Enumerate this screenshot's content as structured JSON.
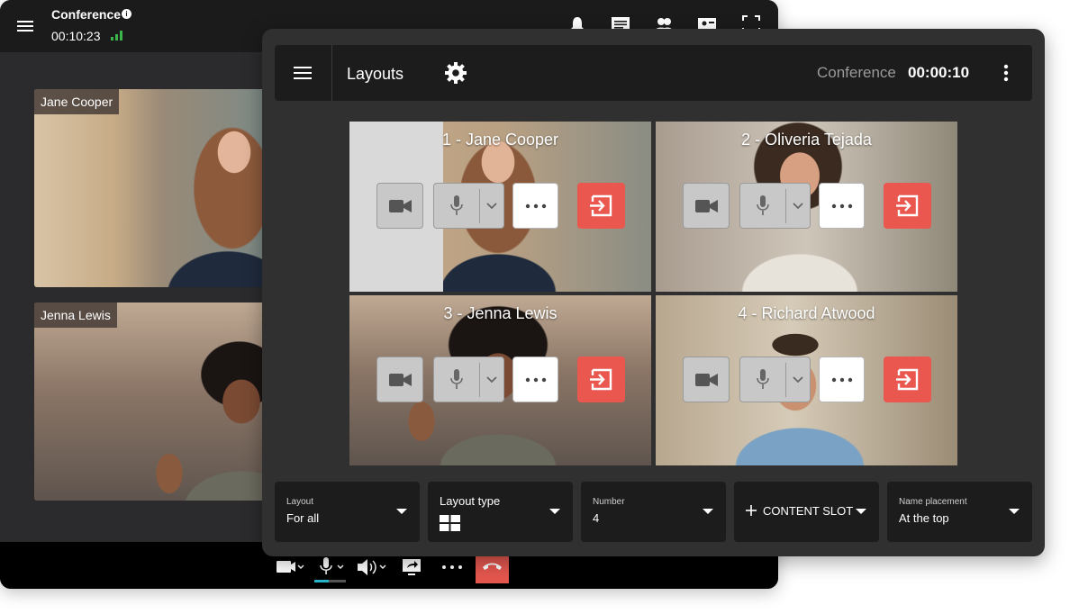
{
  "back_window": {
    "title": "Conference",
    "info": "i",
    "elapsed": "00:10:23",
    "participants": [
      {
        "name": "Jane Cooper"
      },
      {
        "name": "Jenna Lewis"
      }
    ]
  },
  "front_panel": {
    "header": {
      "title": "Layouts",
      "conference_label": "Conference",
      "elapsed": "00:00:10"
    },
    "tiles": [
      {
        "label": "1 - Jane Cooper"
      },
      {
        "label": "2 - Oliveria Tejada"
      },
      {
        "label": "3 - Jenna Lewis"
      },
      {
        "label": "4 - Richard Atwood"
      }
    ],
    "settings_bar": {
      "layout": {
        "caption": "Layout",
        "value": "For all"
      },
      "layout_type": {
        "caption": "Layout type",
        "icon": "grid-2x2-icon"
      },
      "number": {
        "caption": "Number",
        "value": "4"
      },
      "content_slot": {
        "label": "CONTENT SLOT"
      },
      "name_placement": {
        "caption": "Name placement",
        "value": "At the top"
      }
    }
  },
  "colors": {
    "hangup": "#e4574f",
    "exit": "#e9574f",
    "signal": "#3bb54a",
    "mic_level": "#29b3c9"
  }
}
